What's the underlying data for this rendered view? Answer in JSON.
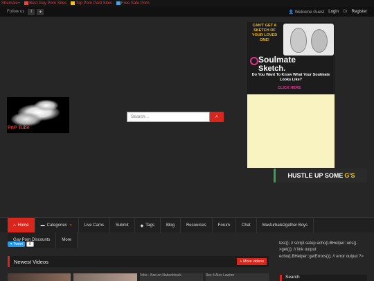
{
  "promo": {
    "items": [
      {
        "label": "Shemale+",
        "flag": null
      },
      {
        "label": "Best Gay Porn Sites",
        "flag": "#e34a3b"
      },
      {
        "label": "Top Porn Paid Sites",
        "flag": "#f2c224"
      },
      {
        "label": "Free Safe Porn",
        "flag": "#4aa3d9"
      }
    ]
  },
  "topbar": {
    "follow_label": "Follow us",
    "social": [
      {
        "icon": "tumblr-icon",
        "glyph": "t"
      },
      {
        "icon": "twitter-icon",
        "glyph": "🐦"
      }
    ],
    "welcome": "Welcome Guest",
    "login": "Login",
    "or": "Or",
    "register": "Register"
  },
  "logo": {
    "text": "PnP Tube"
  },
  "search": {
    "placeholder": "Search..."
  },
  "ad": {
    "hook": "CAN'T GET A SKETCH OF YOUR LOVED ONE!",
    "brand_line1": "Soulmate",
    "brand_line2": "Sketch.",
    "question": "Do You Want To Know What Your Soulmate Looks Like?",
    "cta": "CLICK HERE"
  },
  "banner": {
    "text": "HUSTLE UP SOME",
    "highlight": "G'S"
  },
  "nav": {
    "items": [
      {
        "label": "Home",
        "active": true,
        "icon": "home-icon"
      },
      {
        "label": "Categories",
        "active": false,
        "icon": "folder-icon",
        "dropdown": true
      },
      {
        "label": "Live Cams",
        "active": false
      },
      {
        "label": "Submit",
        "active": false
      },
      {
        "label": "Tags",
        "active": false,
        "icon": "tag-icon"
      },
      {
        "label": "Blog",
        "active": false
      },
      {
        "label": "Resources",
        "active": false
      },
      {
        "label": "Forum",
        "active": false
      },
      {
        "label": "Chat",
        "active": false
      },
      {
        "label": "Masturbate2gether Boys",
        "active": false
      }
    ],
    "row2": [
      {
        "label": "Gay Porn Discounts"
      },
      {
        "label": "More"
      }
    ]
  },
  "tweet": {
    "label": "Tweet",
    "count": "0"
  },
  "newest": {
    "title": "Newest Videos",
    "more_label": "More videos",
    "thumbs": [
      {
        "alt": ""
      },
      {
        "alt": ""
      },
      {
        "alt": "Tribe - Bae on Nakedchuck"
      },
      {
        "alt": "Rex 4 Alex Lawton"
      }
    ]
  },
  "sidebar": {
    "php_note": "test(); // script setup echo(LBHelper::urls()->get()); // link output echo(LBHelper::getErrors()); // error output ?>",
    "search_title": "Search"
  },
  "colors": {
    "accent": "#d9261c",
    "background": "#262626"
  }
}
